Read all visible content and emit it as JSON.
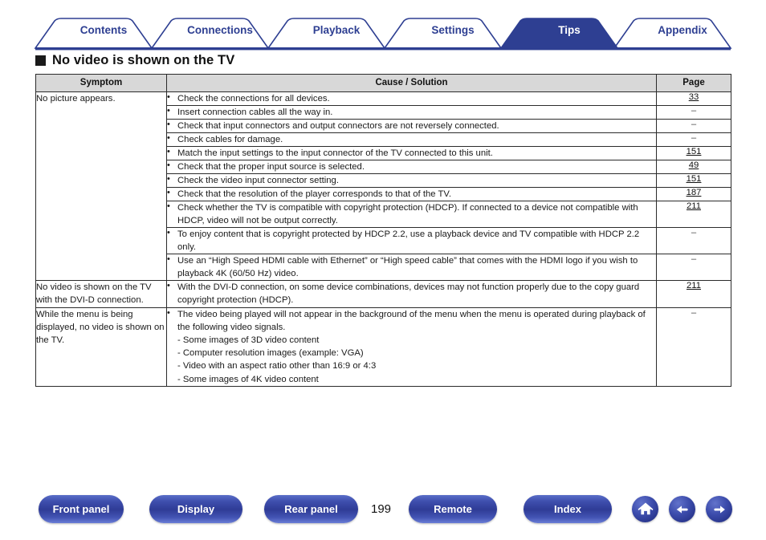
{
  "tabs": [
    {
      "label": "Contents",
      "active": false
    },
    {
      "label": "Connections",
      "active": false
    },
    {
      "label": "Playback",
      "active": false
    },
    {
      "label": "Settings",
      "active": false
    },
    {
      "label": "Tips",
      "active": true
    },
    {
      "label": "Appendix",
      "active": false
    }
  ],
  "heading": {
    "text": "No video is shown on the TV"
  },
  "table": {
    "headers": {
      "symptom": "Symptom",
      "cause": "Cause / Solution",
      "page": "Page"
    },
    "rows": [
      {
        "symptom": "No picture appears.",
        "items": [
          {
            "text": "Check the connections for all devices.",
            "page": "33"
          },
          {
            "text": "Insert connection cables all the way in.",
            "page": "–"
          },
          {
            "text": "Check that input connectors and output connectors are not reversely connected.",
            "page": "–"
          },
          {
            "text": "Check cables for damage.",
            "page": "–"
          },
          {
            "text": "Match the input settings to the input connector of the TV connected to this unit.",
            "page": "151"
          },
          {
            "text": "Check that the proper input source is selected.",
            "page": "49"
          },
          {
            "text": "Check the video input connector setting.",
            "page": "151"
          },
          {
            "text": "Check that the resolution of the player corresponds to that of the TV.",
            "page": "187"
          },
          {
            "text": "Check whether the TV is compatible with copyright protection (HDCP). If connected to a device not compatible with HDCP, video will not be output correctly.",
            "page": "211"
          },
          {
            "text": "To enjoy content that is copyright protected by HDCP 2.2, use a playback device and TV compatible with HDCP 2.2 only.",
            "page": "–"
          },
          {
            "text": "Use an “High Speed HDMI cable with Ethernet” or “High speed cable” that comes with the HDMI logo if you wish to playback 4K (60/50 Hz) video.",
            "page": "–"
          }
        ]
      },
      {
        "symptom": "No video is shown on the TV with the DVI-D connection.",
        "items": [
          {
            "text": "With the DVI-D connection, on some device combinations, devices may not function properly due to the copy guard copyright protection (HDCP).",
            "page": "211"
          }
        ]
      },
      {
        "symptom": "While the menu is being displayed, no video is shown on the TV.",
        "items": [
          {
            "text": "The video being played will not appear in the background of the menu when the menu is operated during playback of the following video signals.",
            "page": "–",
            "subitems": [
              "- Some images of 3D video content",
              "- Computer resolution images (example: VGA)",
              "- Video with an aspect ratio other than 16:9 or 4:3",
              "- Some images of 4K video content"
            ]
          }
        ]
      }
    ]
  },
  "footer": {
    "buttons": [
      {
        "label": "Front panel"
      },
      {
        "label": "Display"
      },
      {
        "label": "Rear panel"
      },
      {
        "label": "Remote"
      },
      {
        "label": "Index"
      }
    ],
    "page_number": "199",
    "icons": [
      {
        "name": "home-icon"
      },
      {
        "name": "arrow-left-icon"
      },
      {
        "name": "arrow-right-icon"
      }
    ]
  },
  "colors": {
    "accent": "#2e3f92",
    "tab_active_bg": "#2e3f92",
    "header_bg": "#d8d8d8"
  }
}
